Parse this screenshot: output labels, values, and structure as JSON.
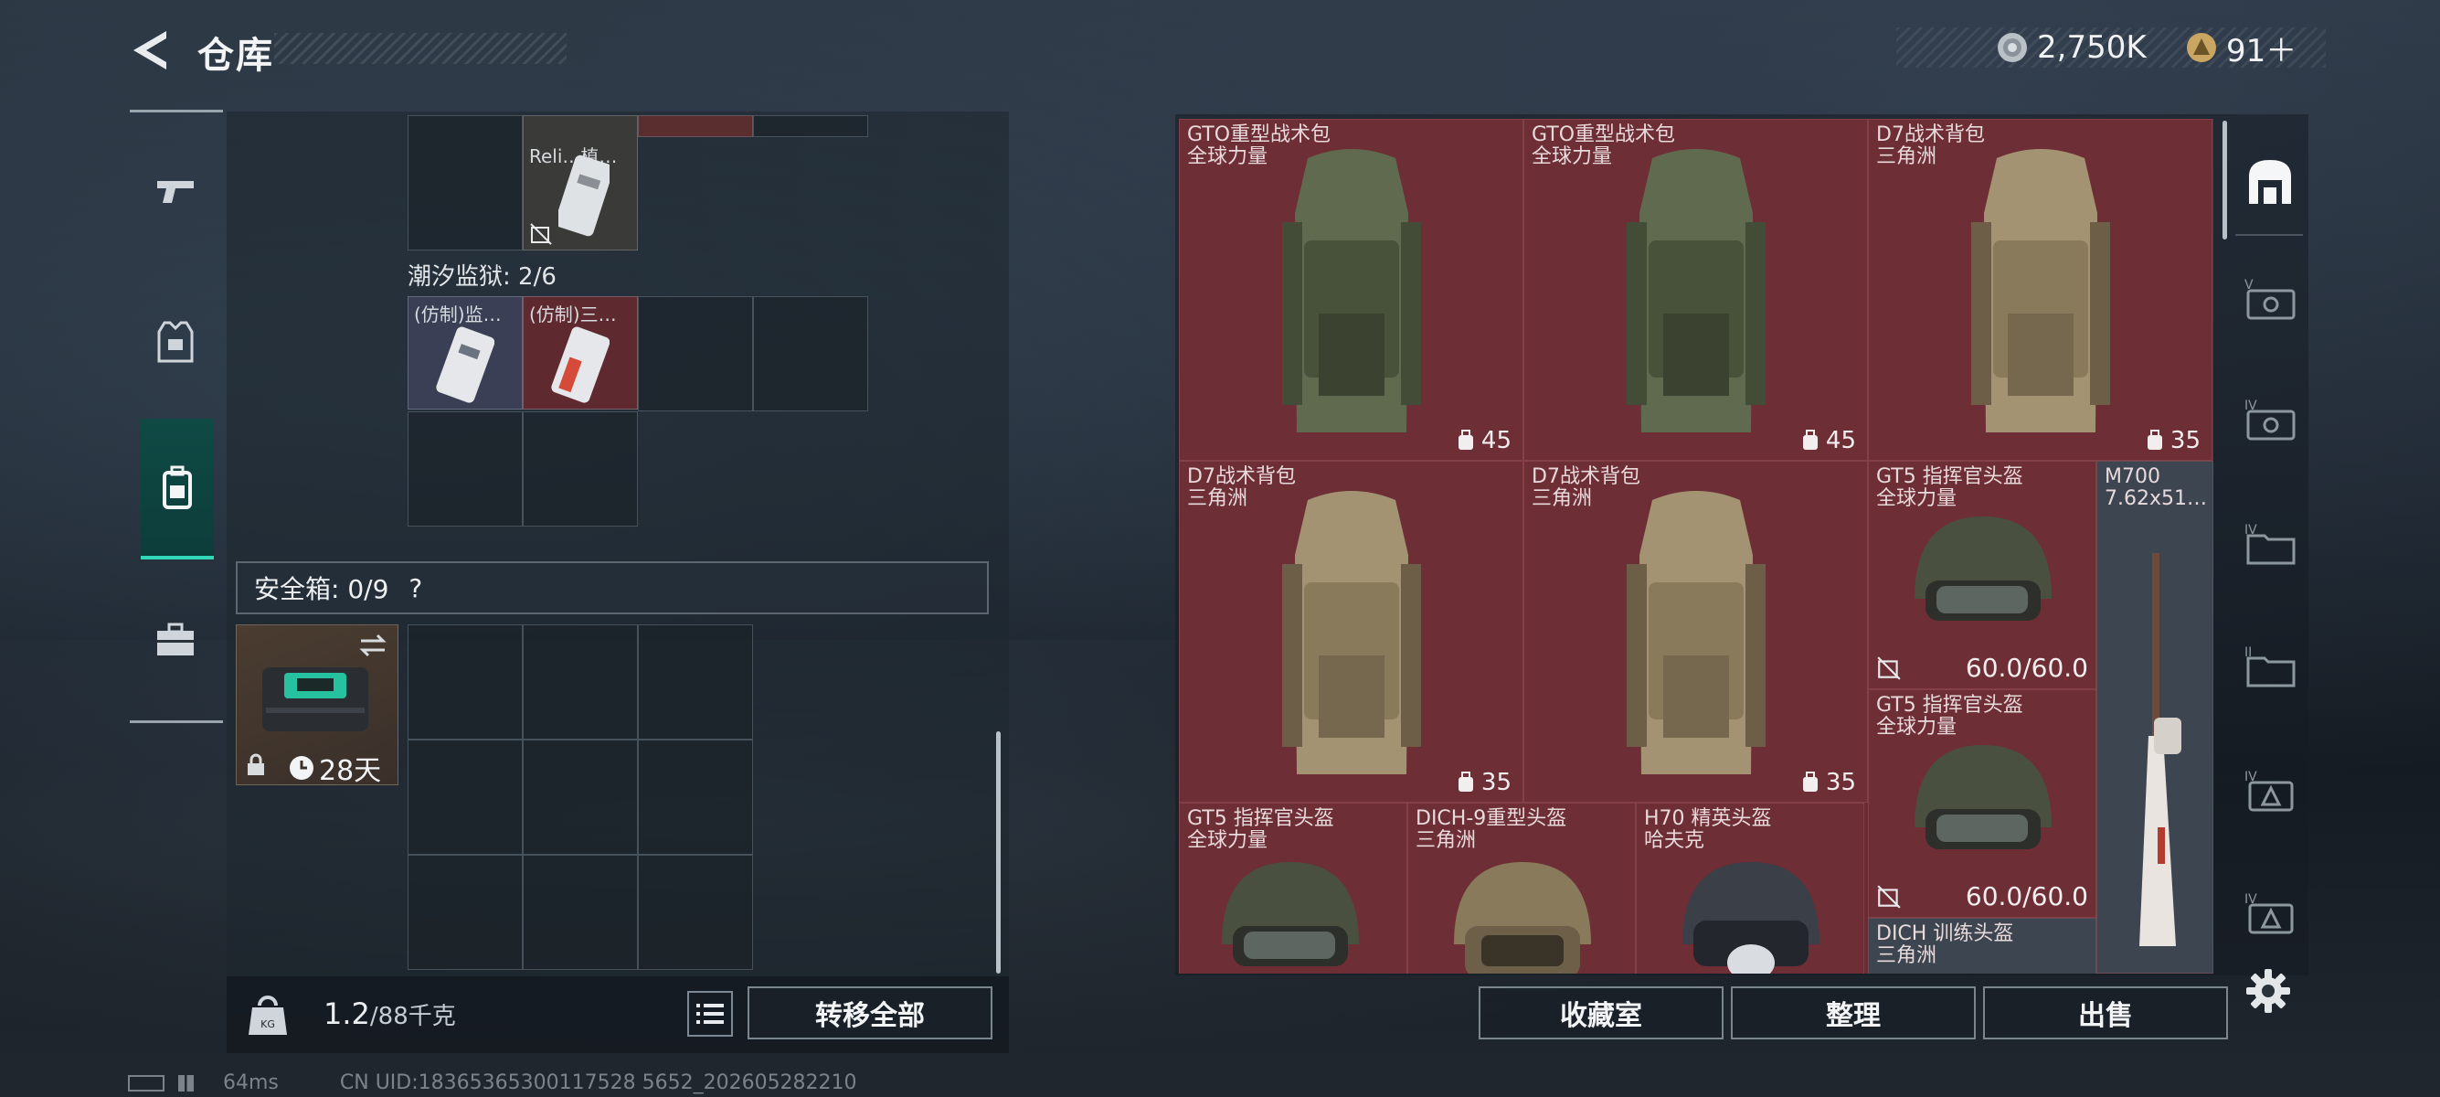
{
  "header": {
    "title": "仓库",
    "currency_silver": "2,750K",
    "currency_gold": "91＋"
  },
  "left": {
    "top_item_label": "Reli…植…",
    "section_label": "潮汐监狱: 2/6",
    "item_a_label": "(仿制)监…",
    "item_b_label": "(仿制)三…",
    "safebox_label": "安全箱: 0/9",
    "safebox_help": "?",
    "safebox_timer": "28天",
    "weight_current": "1.2",
    "weight_max": "/88千克",
    "transfer_all": "转移全部"
  },
  "right": {
    "items": [
      {
        "line1": "GTO重型战术包",
        "line2": "全球力量",
        "badge": "45"
      },
      {
        "line1": "GTO重型战术包",
        "line2": "全球力量",
        "badge": "45"
      },
      {
        "line1": "D7战术背包",
        "line2": "三角洲",
        "badge": "35"
      },
      {
        "line1": "D7战术背包",
        "line2": "三角洲",
        "badge": "35"
      },
      {
        "line1": "D7战术背包",
        "line2": "三角洲",
        "badge": "35"
      },
      {
        "line1": "GT5 指挥官头盔",
        "line2": "全球力量",
        "durability": "60.0/60.0"
      },
      {
        "line1": "M700",
        "line2": "7.62x51…"
      },
      {
        "line1": "GT5 指挥官头盔",
        "line2": "全球力量",
        "durability": "60.0/60.0"
      },
      {
        "line1": "GT5 指挥官头盔",
        "line2": "全球力量"
      },
      {
        "line1": "DICH-9重型头盔",
        "line2": "三角洲"
      },
      {
        "line1": "H70 精英头盔",
        "line2": "哈夫克"
      },
      {
        "line1": "DICH 训练头盔",
        "line2": "三角洲"
      }
    ],
    "collection_button": "收藏室",
    "sort_button": "整理",
    "sell_button": "出售"
  },
  "status_bar": {
    "ping": "64ms",
    "uid": "CN UID:18365365300117528 5652_202605282210"
  },
  "colors": {
    "accent": "#31d8b8",
    "item_bg": "#6e2e36"
  }
}
